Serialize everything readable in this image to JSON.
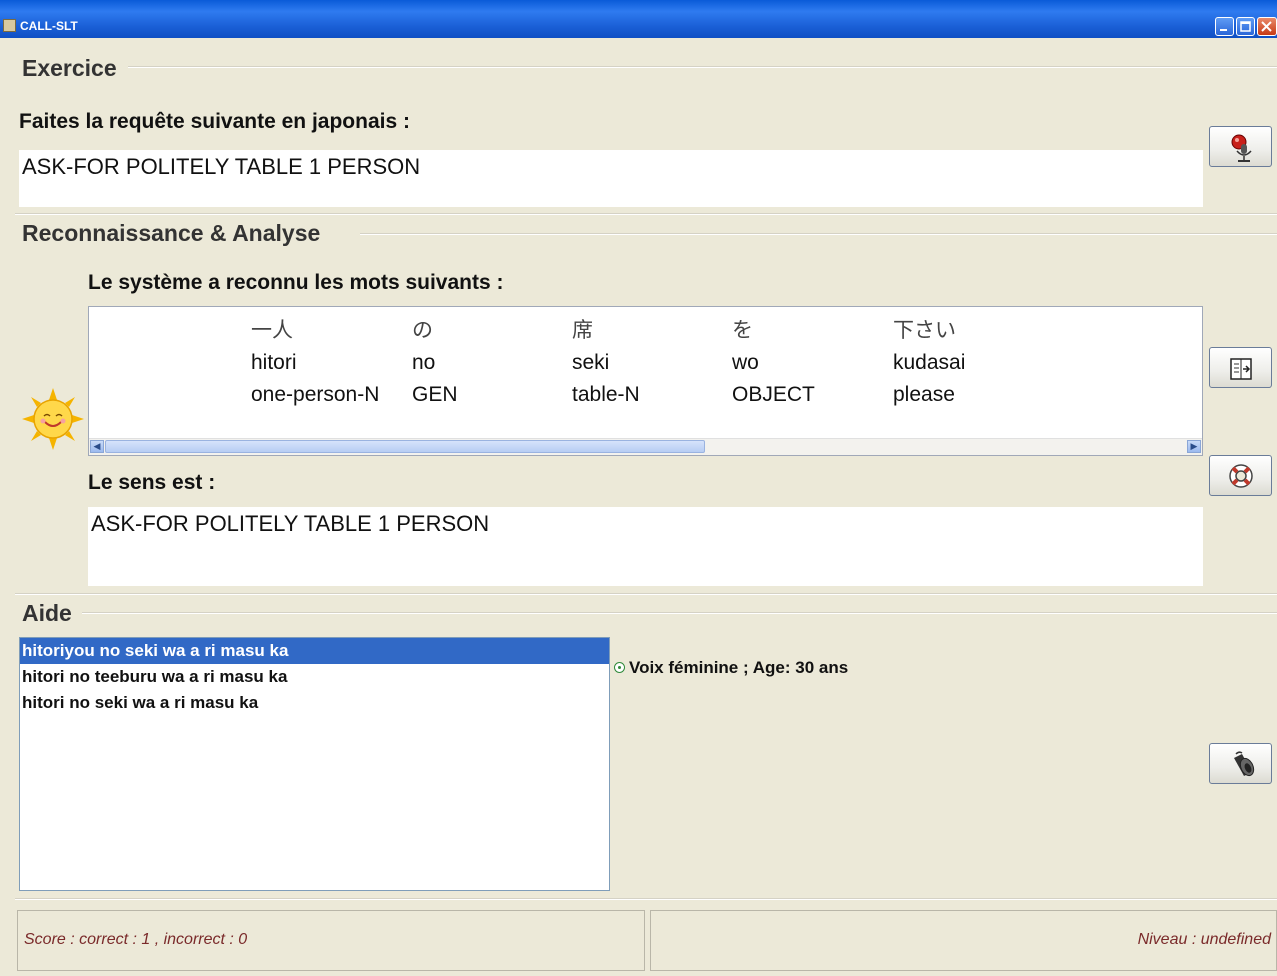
{
  "window": {
    "title": "CALL-SLT"
  },
  "exercise": {
    "heading": "Exercice",
    "prompt_label": "Faites la requête suivante en japonais :",
    "prompt_text": "ASK-FOR POLITELY TABLE 1 PERSON"
  },
  "recognition": {
    "heading": "Reconnaissance & Analyse",
    "words_label": "Le système a reconnu les mots suivants :",
    "words": [
      {
        "jp": "一人",
        "romaji": "hitori",
        "gloss": "one-person-N"
      },
      {
        "jp": "の",
        "romaji": "no",
        "gloss": "GEN"
      },
      {
        "jp": "席",
        "romaji": "seki",
        "gloss": "table-N"
      },
      {
        "jp": "を",
        "romaji": "wo",
        "gloss": "OBJECT"
      },
      {
        "jp": "下さい",
        "romaji": "kudasai",
        "gloss": "please"
      }
    ],
    "meaning_label": "Le sens est :",
    "meaning_text": "ASK-FOR POLITELY TABLE 1 PERSON"
  },
  "help": {
    "heading": "Aide",
    "items": [
      "hitoriyou no seki wa a ri masu ka",
      "hitori no teeburu wa a ri masu ka",
      "hitori no seki wa a ri masu ka"
    ],
    "selected_index": 0,
    "voice_label": "Voix féminine ; Age: 30 ans"
  },
  "status": {
    "score": "Score  : correct : 1 , incorrect : 0",
    "level": "Niveau  : undefined"
  },
  "icons": {
    "record": "microphone-record-icon",
    "translate": "book-arrow-icon",
    "help": "lifebuoy-icon",
    "play": "speaker-play-icon",
    "feedback": "smiling-sun-icon"
  }
}
